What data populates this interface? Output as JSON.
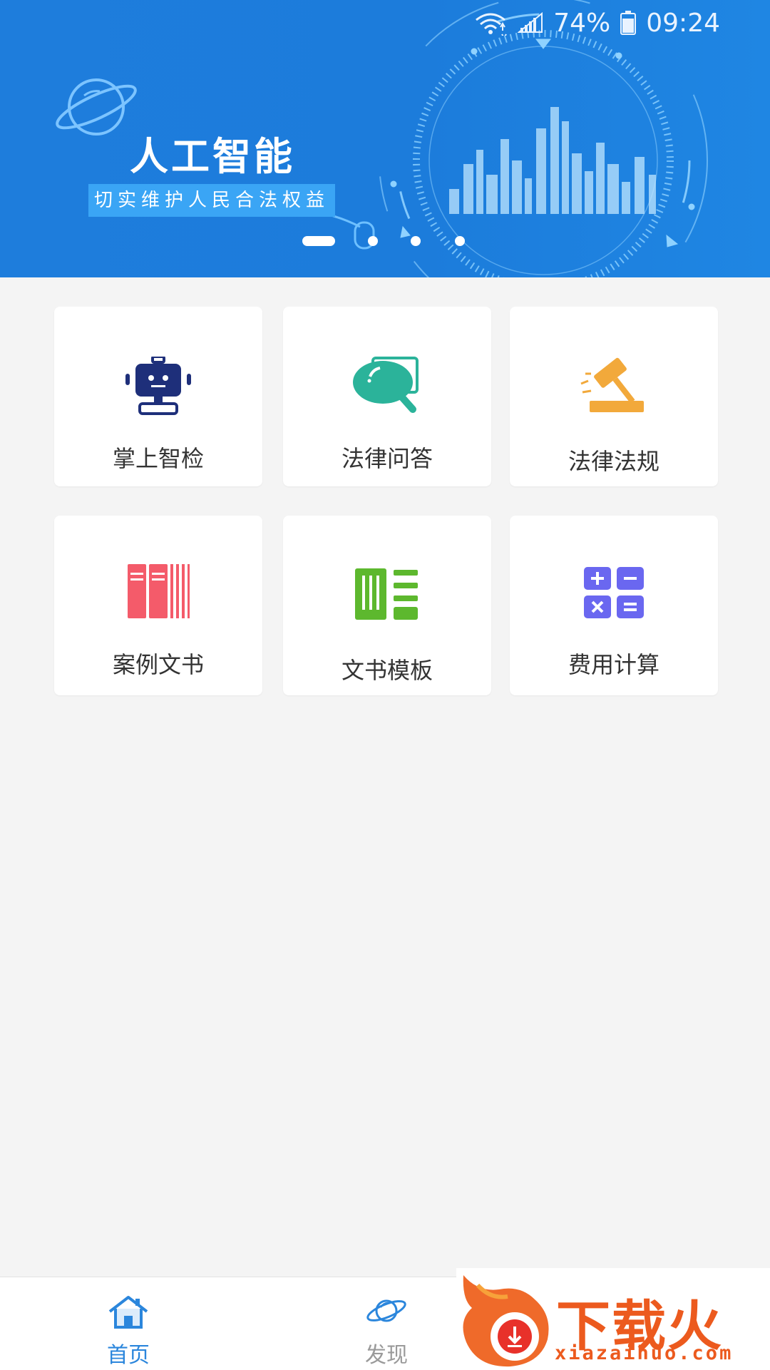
{
  "status_bar": {
    "battery": "74%",
    "time": "09:24"
  },
  "banner": {
    "title": "人工智能",
    "subtitle": "切实维护人民合法权益",
    "slide_count": 4,
    "active_slide": 1
  },
  "grid": [
    {
      "label": "掌上智检",
      "icon": "robot-icon",
      "color": "#1e2f7a"
    },
    {
      "label": "法律问答",
      "icon": "chat-search-icon",
      "color": "#2bb39a"
    },
    {
      "label": "法律法规",
      "icon": "gavel-icon",
      "color": "#f2a93b"
    },
    {
      "label": "案例文书",
      "icon": "books-icon",
      "color": "#f45b6a"
    },
    {
      "label": "文书模板",
      "icon": "template-icon",
      "color": "#5db82e"
    },
    {
      "label": "费用计算",
      "icon": "calculator-icon",
      "color": "#6a67f0"
    }
  ],
  "bottom_nav": {
    "items": [
      {
        "label": "首页",
        "icon": "home-icon",
        "active": true
      },
      {
        "label": "发现",
        "icon": "planet-icon",
        "active": false
      }
    ],
    "active_color": "#2b86dc"
  },
  "watermark": {
    "brand": "下载火",
    "url": "xiazaihuo.com"
  }
}
